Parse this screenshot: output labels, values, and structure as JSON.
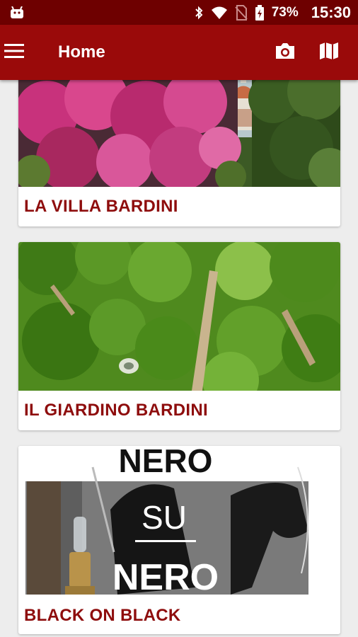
{
  "status_bar": {
    "battery": "73%",
    "time": "15:30"
  },
  "app_bar": {
    "title": "Home",
    "icons": [
      "menu-icon",
      "camera-icon",
      "map-icon"
    ]
  },
  "cards": [
    {
      "title": "LA VILLA BARDINI",
      "image": "flowering-garden-florence-dome"
    },
    {
      "title": "IL GIARDINO BARDINI",
      "image": "aerial-garden-trees"
    },
    {
      "title": "BLACK ON BLACK",
      "image": "nero-su-nero-exhibition",
      "image_text": {
        "line1": "NERO",
        "line2": "SU",
        "line3": "NERO"
      }
    }
  ]
}
